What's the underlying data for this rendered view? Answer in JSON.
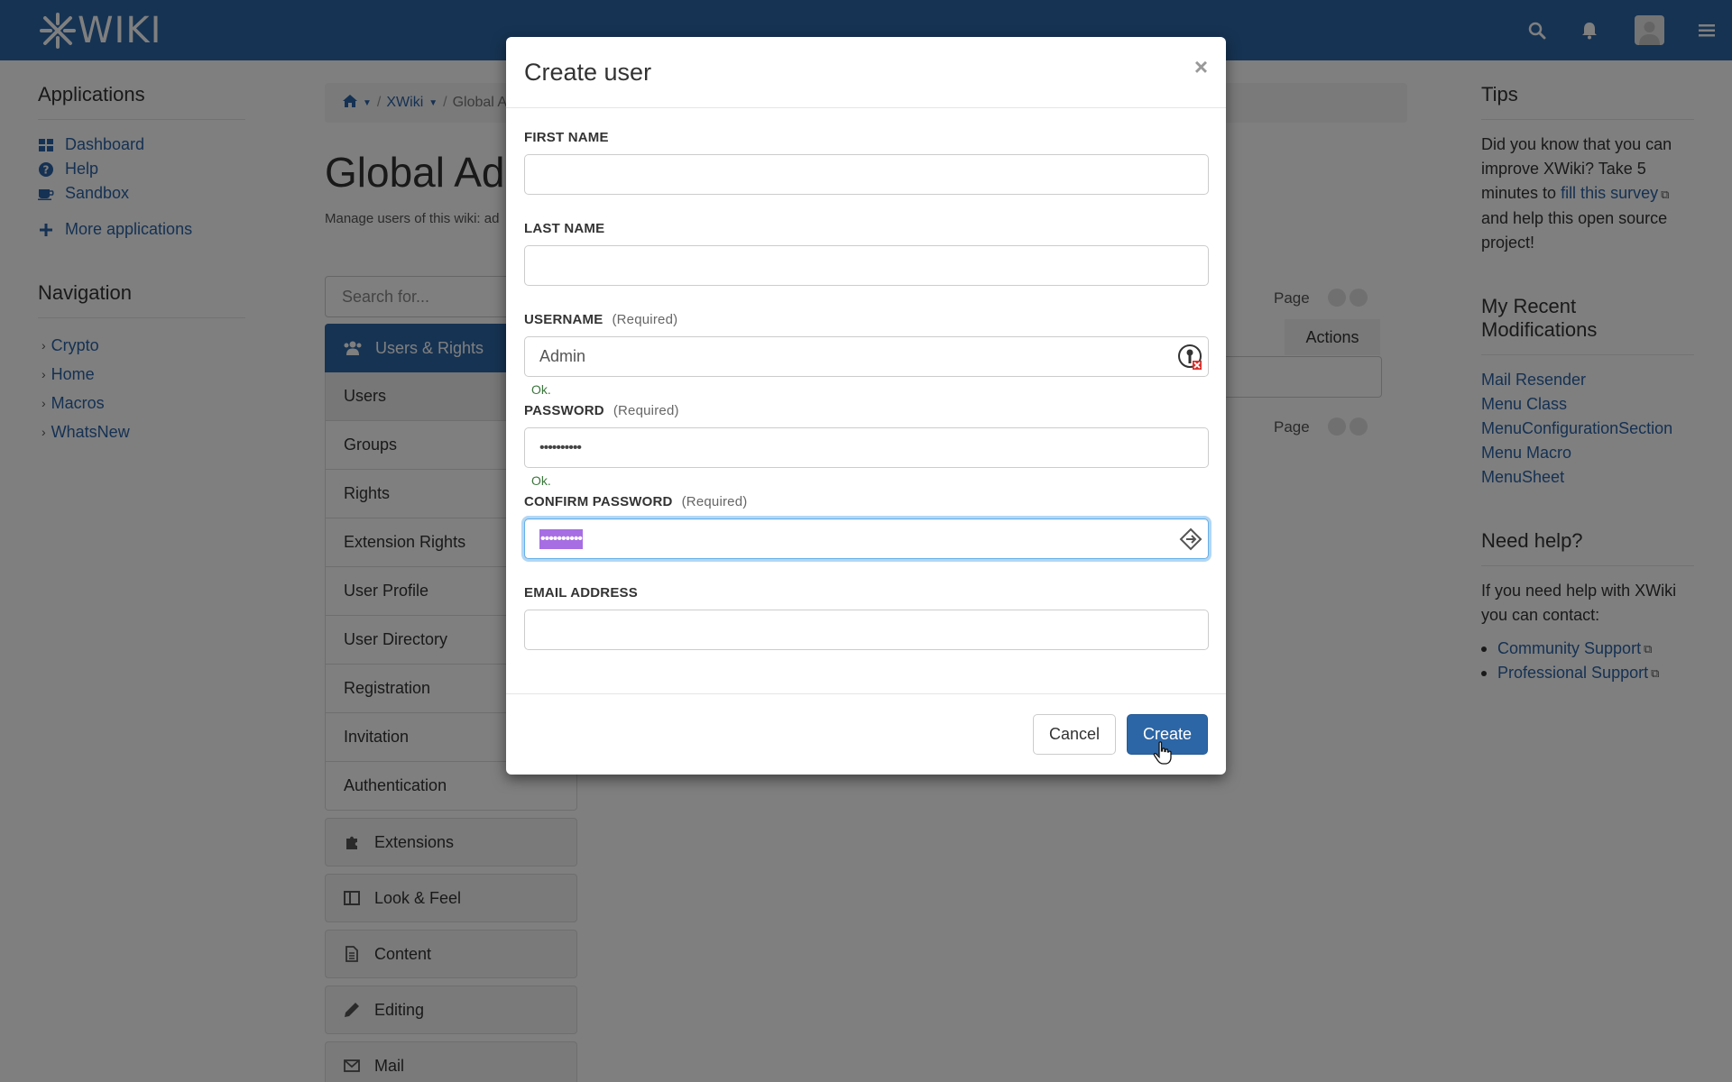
{
  "header": {
    "logo_text": "WIKI",
    "brand_color": "#2c66a6",
    "icons": [
      "search-icon",
      "bell-icon",
      "avatar",
      "hamburger-menu-icon"
    ]
  },
  "left_panel": {
    "applications_title": "Applications",
    "applications": [
      {
        "label": "Dashboard",
        "icon": "dashboard-icon"
      },
      {
        "label": "Help",
        "icon": "help-icon"
      },
      {
        "label": "Sandbox",
        "icon": "coffee-icon"
      }
    ],
    "more_applications": "More applications",
    "navigation_title": "Navigation",
    "navigation": [
      "Crypto",
      "Home",
      "Macros",
      "WhatsNew"
    ]
  },
  "main": {
    "breadcrumb": {
      "home": "",
      "xwiki": "XWiki",
      "current": "Global A"
    },
    "title": "Global Ad",
    "description": "Manage users of this wiki: ad",
    "search_placeholder": "Search for...",
    "page_label_top": "Page",
    "page_label_bottom": "Page",
    "actions_header": "Actions",
    "menu_head": "Users & Rights",
    "menu_items": [
      "Users",
      "Groups",
      "Rights",
      "Extension Rights",
      "User Profile",
      "User Directory",
      "Registration",
      "Invitation",
      "Authentication"
    ],
    "categories": [
      {
        "label": "Extensions",
        "icon": "puzzle-icon"
      },
      {
        "label": "Look & Feel",
        "icon": "layout-icon"
      },
      {
        "label": "Content",
        "icon": "document-icon"
      },
      {
        "label": "Editing",
        "icon": "pencil-icon"
      },
      {
        "label": "Mail",
        "icon": "envelope-icon"
      }
    ]
  },
  "right_panel": {
    "tips_title": "Tips",
    "tips_text_1": "Did you know that you can improve XWiki? Take 5 minutes to",
    "tips_link": "fill this survey",
    "tips_text_2": "and help this open source project!",
    "recent_title": "My Recent Modifications",
    "recent": [
      "Mail Resender",
      "Menu Class",
      "MenuConfigurationSection",
      "Menu Macro",
      "MenuSheet"
    ],
    "help_title": "Need help?",
    "help_text": "If you need help with XWiki you can contact:",
    "help_links": [
      "Community Support",
      "Professional Support"
    ]
  },
  "modal": {
    "title": "Create user",
    "close": "×",
    "first_name_label": "FIRST NAME",
    "first_name_value": "",
    "last_name_label": "LAST NAME",
    "last_name_value": "",
    "username_label": "USERNAME",
    "username_required": "(Required)",
    "username_value": "Admin",
    "username_ok": "Ok.",
    "password_label": "PASSWORD",
    "password_required": "(Required)",
    "password_value": "••••••••••",
    "password_ok": "Ok.",
    "confirm_label": "CONFIRM PASSWORD",
    "confirm_required": "(Required)",
    "confirm_value": "••••••••••",
    "email_label": "EMAIL ADDRESS",
    "email_value": "",
    "cancel": "Cancel",
    "create": "Create"
  }
}
